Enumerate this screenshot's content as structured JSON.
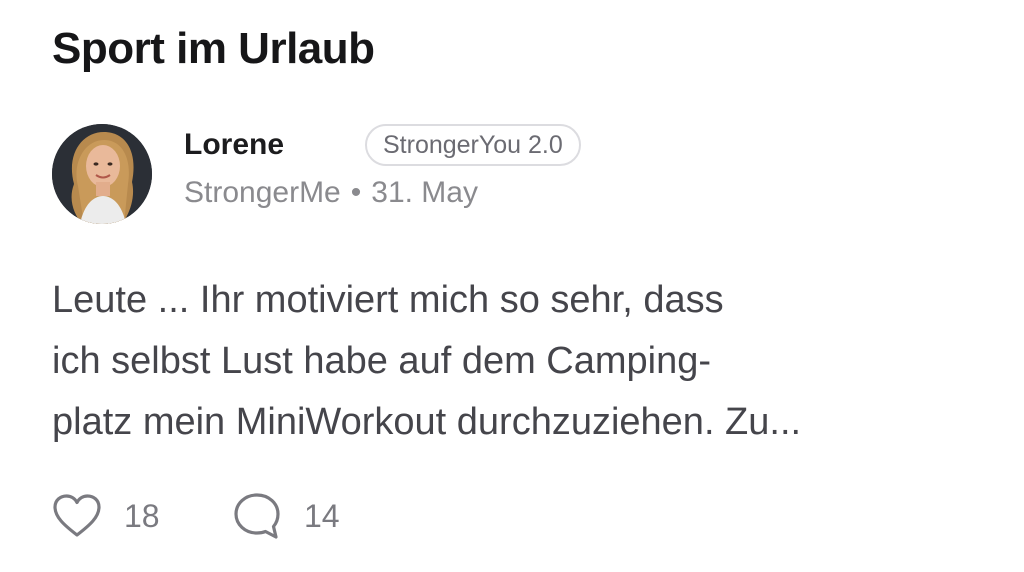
{
  "post": {
    "title": "Sport im Urlaub",
    "author": {
      "name": "Lorene",
      "badge": "StrongerYou 2.0",
      "group": "StrongerMe",
      "separator": "•",
      "date": "31. May",
      "avatar_icon": "user-photo"
    },
    "body_lines": [
      "Leute ... Ihr motiviert mich so sehr, dass",
      "ich selbst Lust habe auf dem Camping-",
      "platz mein MiniWorkout durchzuziehen. Zu..."
    ],
    "actions": {
      "likes": {
        "icon": "heart-icon",
        "count": "18"
      },
      "comments": {
        "icon": "comment-icon",
        "count": "14"
      }
    }
  },
  "colors": {
    "title": "#161618",
    "secondary": "#8a8a8e",
    "body": "#45454b",
    "badge_border": "#dcdce0"
  }
}
